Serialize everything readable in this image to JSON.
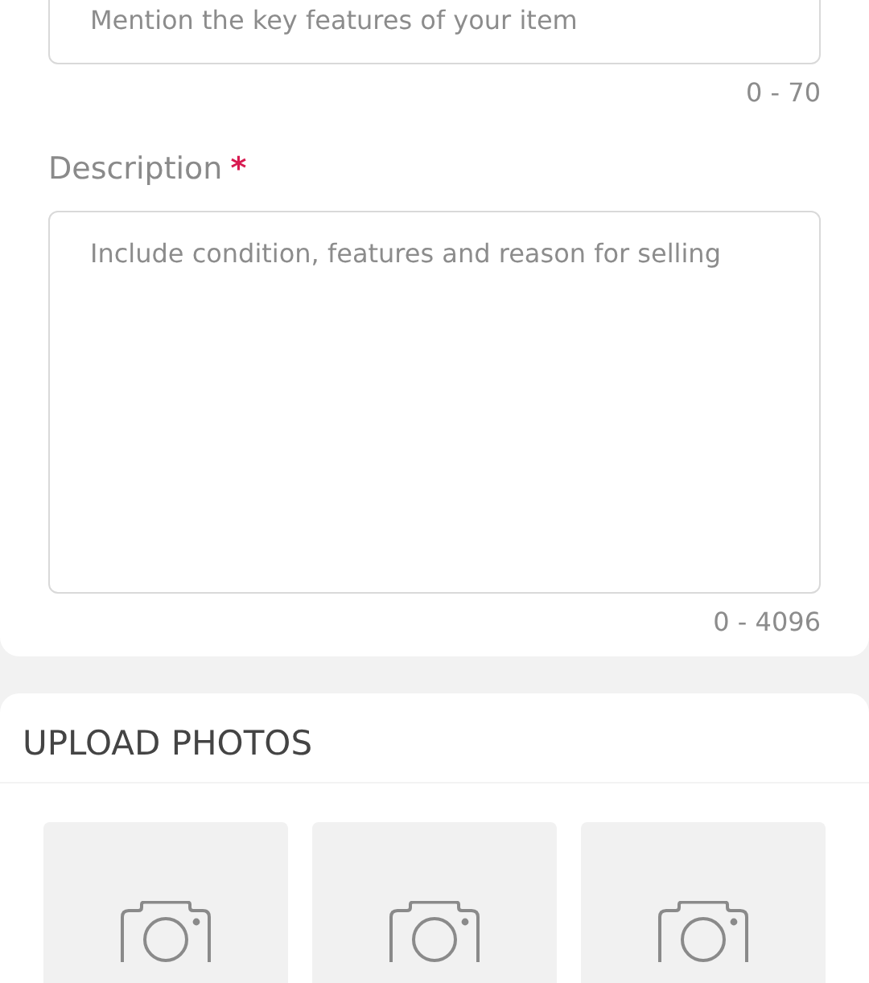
{
  "title_field": {
    "placeholder": "Mention the key features of your item",
    "counter": "0 - 70"
  },
  "description": {
    "label": "Description",
    "required_mark": "*",
    "placeholder": "Include condition, features and reason for selling",
    "counter": "0 - 4096"
  },
  "upload": {
    "heading": "UPLOAD PHOTOS",
    "slots": [
      {
        "kind": "empty"
      },
      {
        "kind": "empty"
      },
      {
        "kind": "empty"
      }
    ]
  }
}
